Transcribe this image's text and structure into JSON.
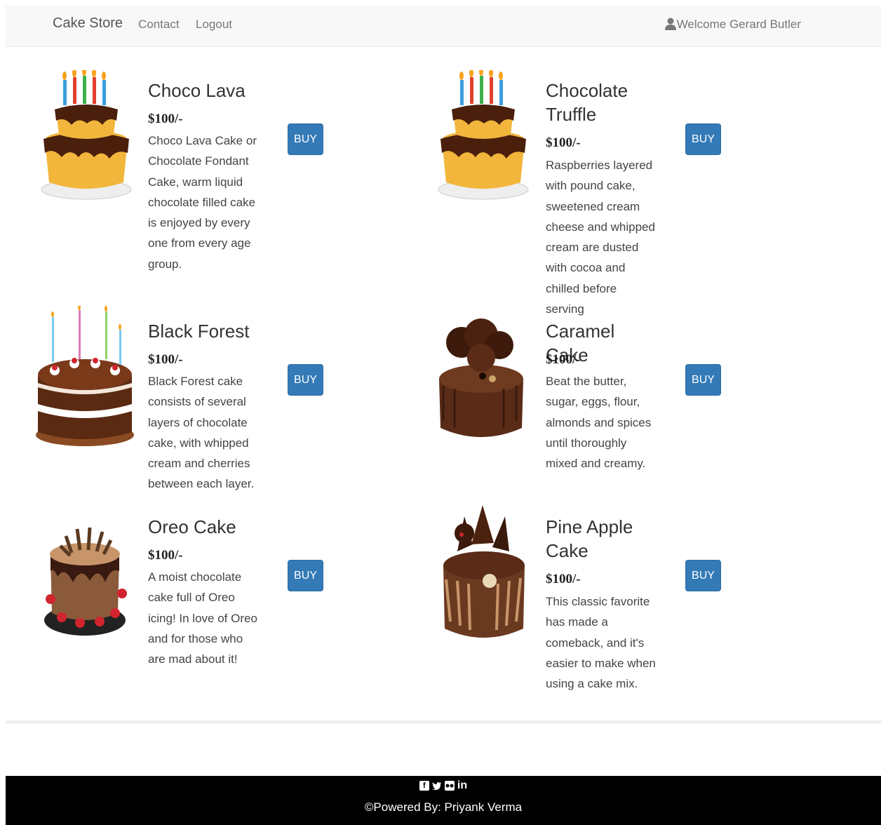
{
  "nav": {
    "brand": "Cake Store",
    "links": [
      "Contact",
      "Logout"
    ],
    "welcome": "Welcome Gerard Butler"
  },
  "products": [
    {
      "name": "Choco Lava",
      "price": "$100/-",
      "description": "Choco Lava Cake or Chocolate Fondant Cake, warm liquid chocolate filled cake is enjoyed by every one from every age group.",
      "button": "BUY"
    },
    {
      "name": "Chocolate Truffle",
      "price": "$100/-",
      "description": "Raspberries layered with pound cake, sweetened cream cheese and whipped cream are dusted with cocoa and chilled before serving",
      "button": "BUY"
    },
    {
      "name": "Black Forest",
      "price": "$100/-",
      "description": "Black Forest cake consists of several layers of chocolate cake, with whipped cream and cherries between each layer.",
      "button": "BUY"
    },
    {
      "name": "Caramel Cake",
      "price": "$100/-",
      "description": "Beat the butter, sugar, eggs, flour, almonds and spices until thoroughly mixed and creamy.",
      "button": "BUY"
    },
    {
      "name": "Oreo Cake",
      "price": "$100/-",
      "description": "A moist chocolate cake full of Oreo icing! In love of Oreo and for those who are mad about it!",
      "button": "BUY"
    },
    {
      "name": "Pine Apple Cake",
      "price": "$100/-",
      "description": "This classic favorite has made a comeback, and it's easier to make when using a cake mix.",
      "button": "BUY"
    }
  ],
  "footer": {
    "social_icons": [
      "facebook-icon",
      "twitter-icon",
      "flickr-icon",
      "linkedin-icon"
    ],
    "powered": "©Powered By: Priyank Verma"
  },
  "colors": {
    "primary": "#337ab7",
    "navbar_bg": "#f8f8f8",
    "footer_bg": "#000000"
  }
}
